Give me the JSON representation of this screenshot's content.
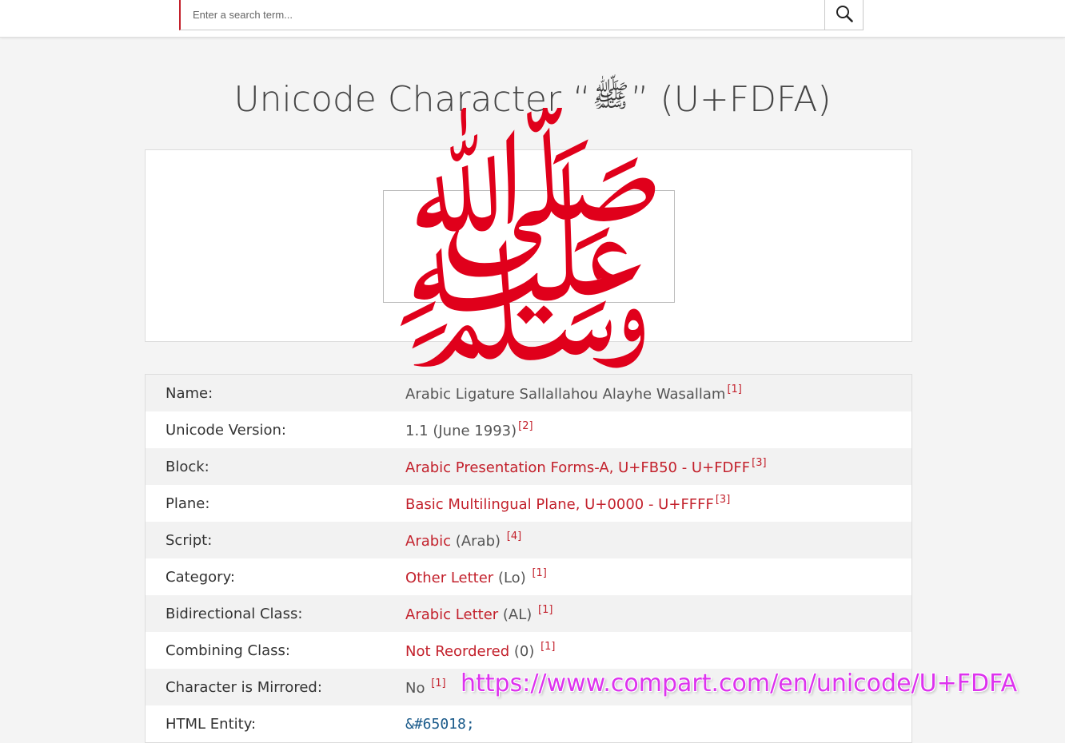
{
  "search": {
    "placeholder": "Enter a search term...",
    "icon": "search-icon"
  },
  "title": {
    "prefix": "Unicode Character “",
    "glyph": "ﷺ",
    "suffix": "” (U+FDFA)"
  },
  "glyph": {
    "char": "ﷺ",
    "color": "#e0001b"
  },
  "colors": {
    "accent": "#c3212c",
    "link": "#c3212c",
    "watermark": "#dd33ee"
  },
  "rows": [
    {
      "label": "Name:",
      "link": "",
      "plain": "Arabic Ligature Sallallahou Alayhe Wasallam",
      "ref": "[1]"
    },
    {
      "label": "Unicode Version:",
      "link": "",
      "plain": "1.1 (June 1993)",
      "ref": "[2]"
    },
    {
      "label": "Block:",
      "link": "Arabic Presentation Forms-A, U+FB50 - U+FDFF",
      "plain": "",
      "ref": "[3]"
    },
    {
      "label": "Plane:",
      "link": "Basic Multilingual Plane, U+0000 - U+FFFF",
      "plain": "",
      "ref": "[3]"
    },
    {
      "label": "Script:",
      "link": "Arabic",
      "plain": " (Arab) ",
      "ref": "[4]"
    },
    {
      "label": "Category:",
      "link": "Other Letter",
      "plain": " (Lo) ",
      "ref": "[1]"
    },
    {
      "label": "Bidirectional Class:",
      "link": "Arabic Letter",
      "plain": " (AL) ",
      "ref": "[1]"
    },
    {
      "label": "Combining Class:",
      "link": "Not Reordered",
      "plain": " (0) ",
      "ref": "[1]"
    },
    {
      "label": "Character is Mirrored:",
      "link": "",
      "plain": "No ",
      "ref": "[1]"
    },
    {
      "label": "HTML Entity:",
      "entity": "&#65018;"
    }
  ],
  "watermark": "https://www.compart.com/en/unicode/U+FDFA"
}
